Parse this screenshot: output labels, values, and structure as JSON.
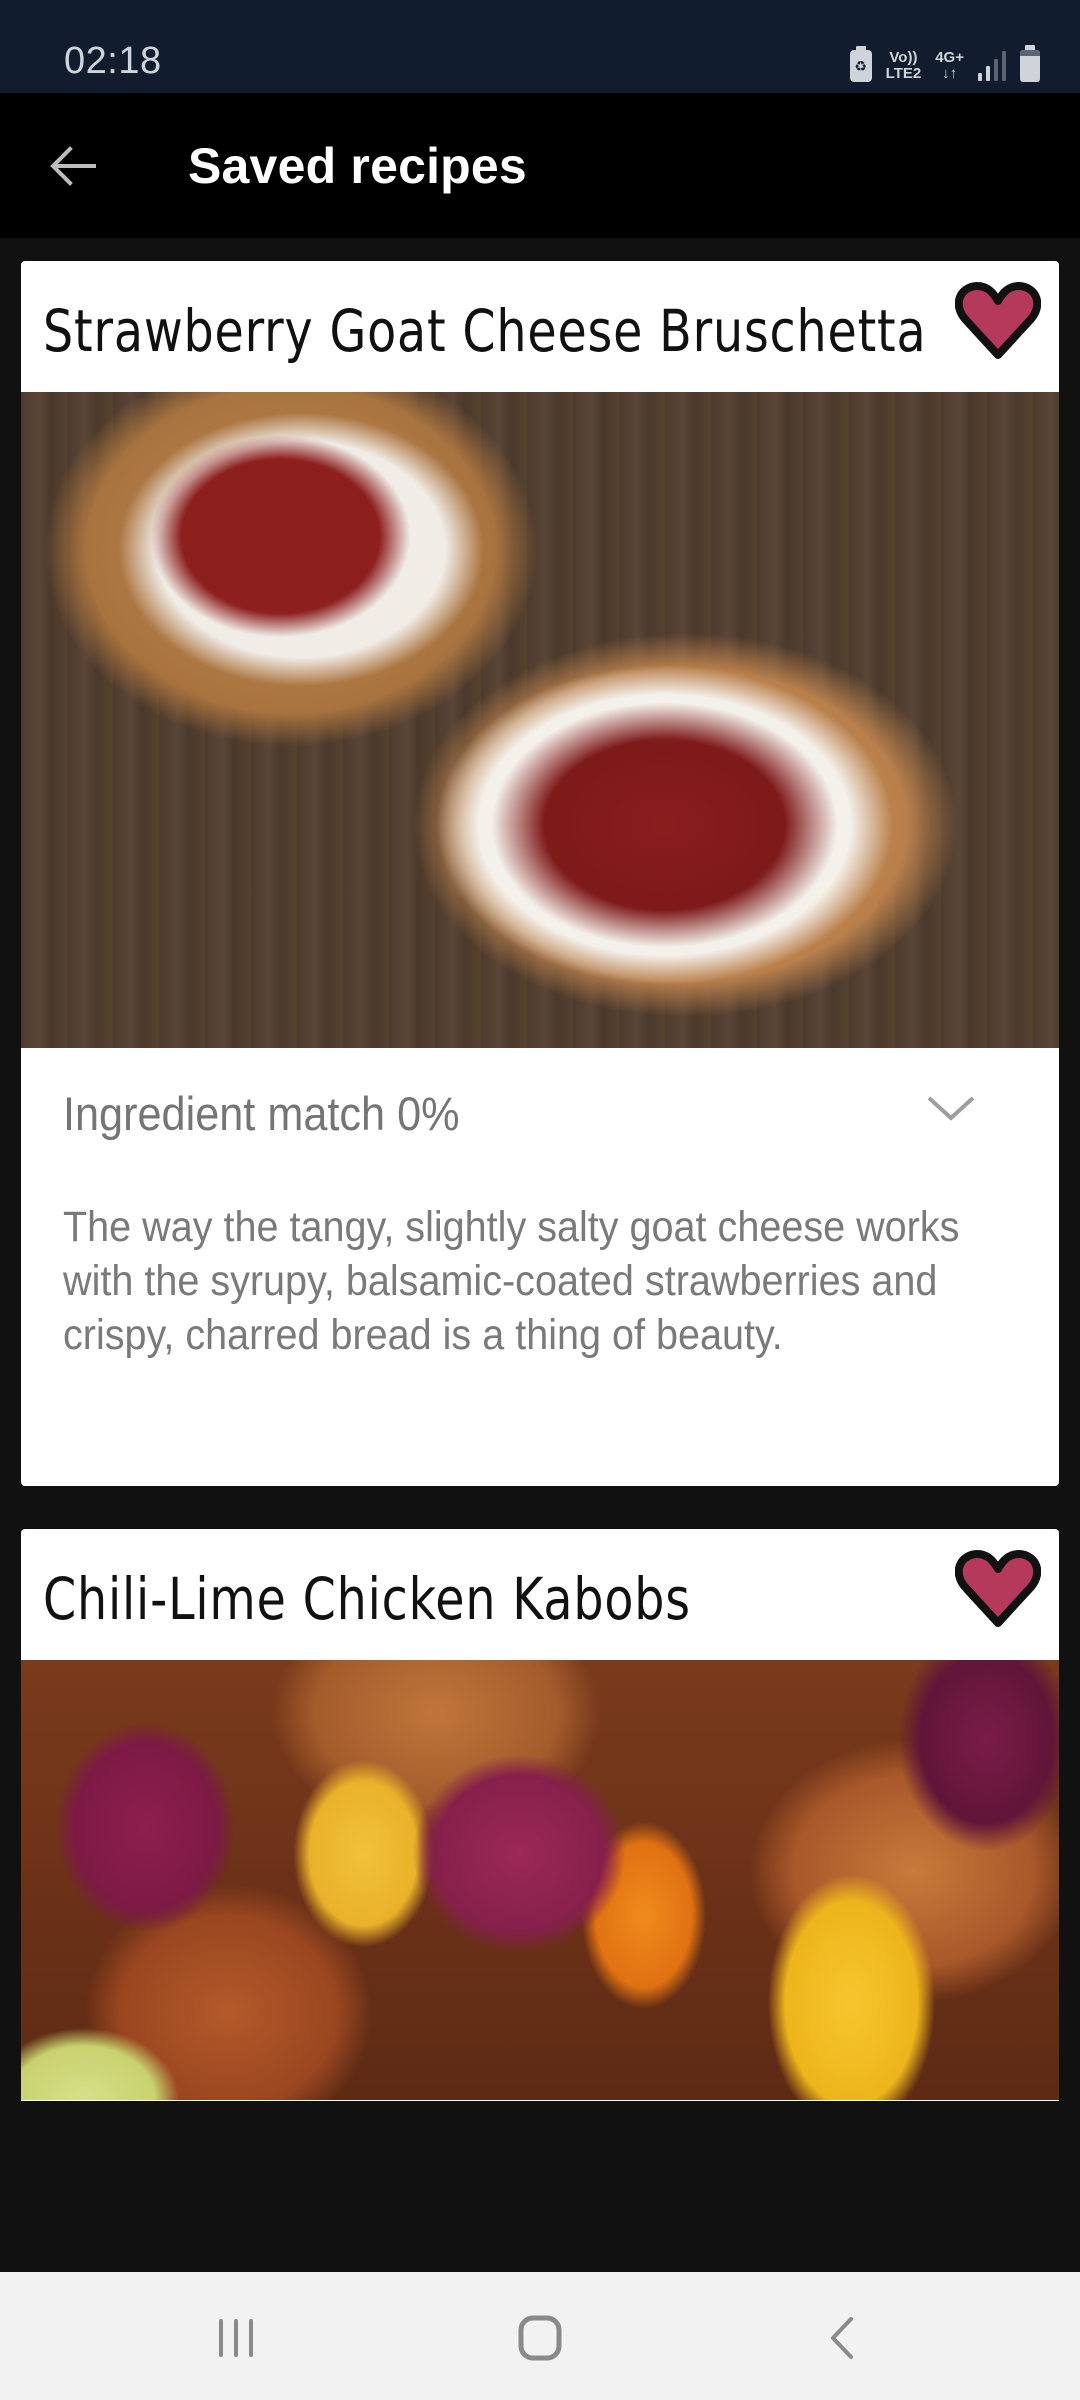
{
  "status_bar": {
    "time": "02:18",
    "icons": [
      "battery-saver-icon",
      "volte-lte2-icon",
      "4g-plus-data-icon",
      "signal-icon",
      "battery-icon"
    ],
    "volte_label_top": "Vo))",
    "volte_label_bottom": "LTE2",
    "network_label_top": "4G+",
    "network_label_bottom": "↓↑",
    "battery_saver_glyph": "♻"
  },
  "app_bar": {
    "back_icon": "arrow-left-icon",
    "title": "Saved recipes"
  },
  "recipes": [
    {
      "title": "Strawberry Goat Cheese Bruschetta",
      "favorite": true,
      "favorite_icon": "heart-icon",
      "image_alt": "Grilled bread topped with goat cheese and balsamic strawberries",
      "ingredient_match_label": "Ingredient match 0%",
      "ingredient_match_percent": 0,
      "expand_icon": "chevron-down-icon",
      "description": "The way the tangy, slightly salty goat cheese works with the syrupy, balsamic-coated strawberries and crispy, charred bread is a thing of beauty."
    },
    {
      "title": "Chili-Lime Chicken Kabobs",
      "favorite": true,
      "favorite_icon": "heart-icon",
      "image_alt": "Grilled chicken kabobs with red onion, pineapple and peppers"
    }
  ],
  "colors": {
    "status_bar_bg": "#111d2e",
    "app_bar_bg": "#000000",
    "page_bg": "#111111",
    "card_bg": "#ffffff",
    "heart_fill": "#b5395a",
    "secondary_text": "#757575",
    "nav_bar_bg": "#f2f2f2"
  },
  "nav_bar": {
    "recents_icon": "recents-icon",
    "home_icon": "home-icon",
    "back_icon": "back-chevron-icon"
  }
}
